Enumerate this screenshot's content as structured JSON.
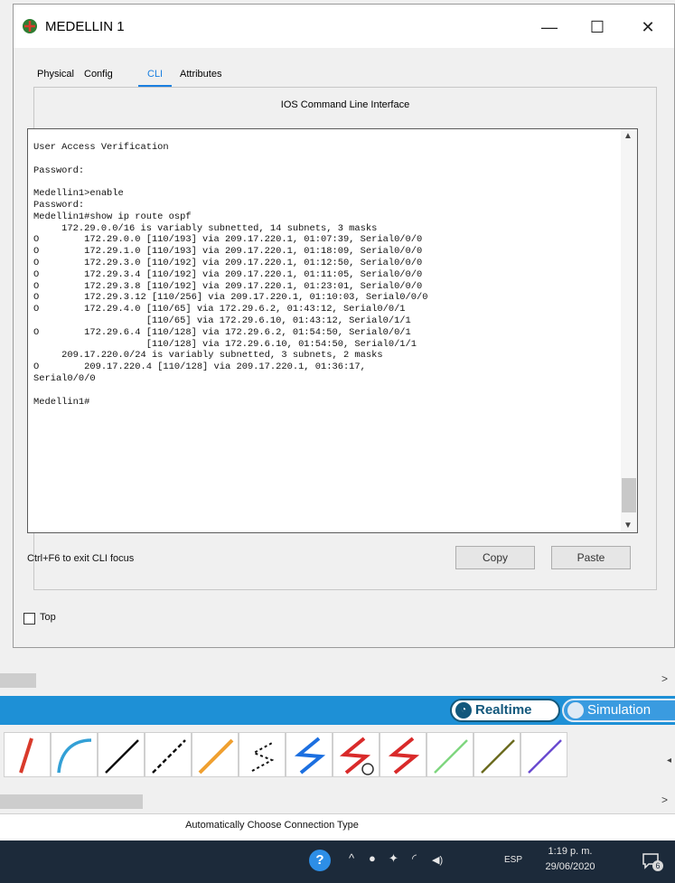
{
  "window": {
    "title": "MEDELLIN 1",
    "minimize_glyph": "—",
    "maximize_glyph": "☐",
    "close_glyph": "✕"
  },
  "tabs": [
    {
      "label": "Physical"
    },
    {
      "label": "Config"
    },
    {
      "label": "CLI"
    },
    {
      "label": "Attributes"
    }
  ],
  "cli": {
    "header": "IOS Command Line Interface",
    "lines": [
      "User Access Verification",
      "",
      "Password:",
      "",
      "Medellin1>enable",
      "Password:",
      "Medellin1#show ip route ospf",
      "     172.29.0.0/16 is variably subnetted, 14 subnets, 3 masks",
      "O        172.29.0.0 [110/193] via 209.17.220.1, 01:07:39, Serial0/0/0",
      "O        172.29.1.0 [110/193] via 209.17.220.1, 01:18:09, Serial0/0/0",
      "O        172.29.3.0 [110/192] via 209.17.220.1, 01:12:50, Serial0/0/0",
      "O        172.29.3.4 [110/192] via 209.17.220.1, 01:11:05, Serial0/0/0",
      "O        172.29.3.8 [110/192] via 209.17.220.1, 01:23:01, Serial0/0/0",
      "O        172.29.3.12 [110/256] via 209.17.220.1, 01:10:03, Serial0/0/0",
      "O        172.29.4.0 [110/65] via 172.29.6.2, 01:43:12, Serial0/0/1",
      "                    [110/65] via 172.29.6.10, 01:43:12, Serial0/1/1",
      "O        172.29.6.4 [110/128] via 172.29.6.2, 01:54:50, Serial0/0/1",
      "                    [110/128] via 172.29.6.10, 01:54:50, Serial0/1/1",
      "     209.17.220.0/24 is variably subnetted, 3 subnets, 2 masks",
      "O        209.17.220.4 [110/128] via 209.17.220.1, 01:36:17,",
      "Serial0/0/0",
      "",
      "Medellin1#"
    ],
    "exit_hint": "Ctrl+F6 to exit CLI focus",
    "copy_label": "Copy",
    "paste_label": "Paste",
    "top_label": "Top"
  },
  "mode": {
    "realtime_label": "Realtime",
    "simulation_label": "Simulation"
  },
  "connections": [
    {
      "icon": "automatic-connection-icon",
      "color": "#d93a2b"
    },
    {
      "icon": "console-cable-icon",
      "color": "#33a0d6"
    },
    {
      "icon": "copper-straight-through-icon",
      "color": "#111111"
    },
    {
      "icon": "copper-cross-over-icon",
      "color": "#111111"
    },
    {
      "icon": "fiber-icon",
      "color": "#f0a030"
    },
    {
      "icon": "phone-cable-icon",
      "color": "#111111"
    },
    {
      "icon": "coaxial-cable-icon",
      "color": "#1c6fe0"
    },
    {
      "icon": "serial-dce-icon",
      "color": "#d92a2a"
    },
    {
      "icon": "serial-dte-icon",
      "color": "#d92a2a"
    },
    {
      "icon": "octal-cable-icon",
      "color": "#7fd67f"
    },
    {
      "icon": "iot-custom-cable-icon",
      "color": "#6b6b20"
    },
    {
      "icon": "usb-cable-icon",
      "color": "#6a4bd0"
    }
  ],
  "status_bar": {
    "text": "Automatically Choose Connection Type"
  },
  "taskbar": {
    "help_glyph": "?",
    "chevron_glyph": "^",
    "language": "ESP",
    "time": "1:19 p. m.",
    "date": "29/06/2020",
    "notification_count": "6"
  }
}
